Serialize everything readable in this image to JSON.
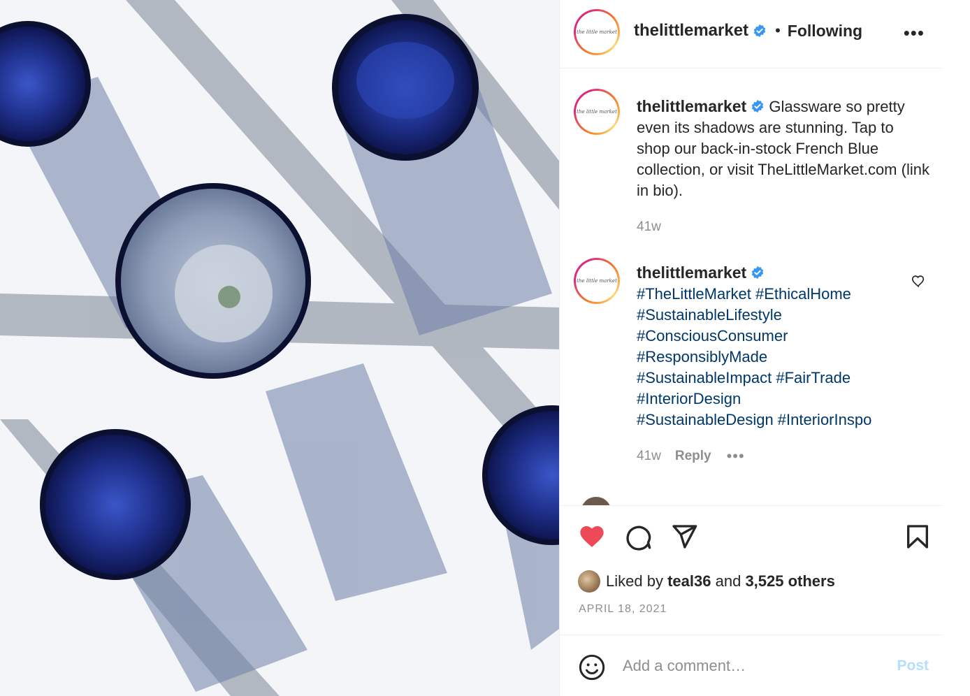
{
  "post": {
    "username": "thelittlemarket",
    "avatar_logo_text": "the little market",
    "follow_status": "Following",
    "separator": "•",
    "more_label": "•••",
    "caption": {
      "username": "thelittlemarket",
      "text": "Glassware so pretty even its shadows are stunning. Tap to shop our back-in-stock French Blue collection, or visit TheLittleMarket.com (link in bio).",
      "age": "41w"
    },
    "comment": {
      "username": "thelittlemarket",
      "hashtags": [
        "#TheLittleMarket #EthicalHome",
        "#SustainableLifestyle",
        "#ConsciousConsumer",
        "#ResponsiblyMade",
        "#SustainableImpact #FairTrade",
        "#InteriorDesign",
        "#SustainableDesign #InteriorInspo"
      ],
      "age": "41w",
      "reply_label": "Reply",
      "more_label": "•••"
    },
    "likes": {
      "prefix": "Liked by",
      "user": "teal36",
      "middle": "and",
      "others": "3,525 others"
    },
    "date": "APRIL 18, 2021",
    "add_comment": {
      "placeholder": "Add a comment…",
      "post_label": "Post"
    }
  },
  "colors": {
    "like_red": "#ed4956",
    "verified_blue": "#3897f0",
    "hashtag_blue": "#00376b",
    "muted": "#8e8e8e",
    "post_disabled": "#b2dffc",
    "glass_blue": "#1e2f8a"
  },
  "icons": {
    "like": "heart-filled-icon",
    "comment": "comment-bubble-icon",
    "share": "paper-plane-icon",
    "save": "bookmark-icon",
    "emoji": "smiley-icon",
    "verified": "verified-badge-icon"
  }
}
